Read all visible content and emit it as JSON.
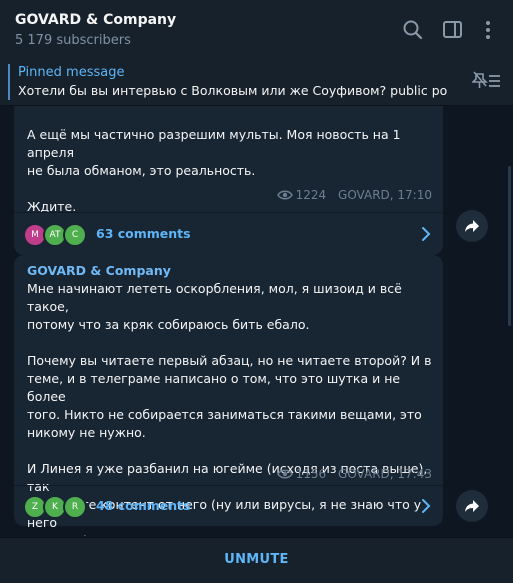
{
  "header": {
    "title": "GOVARD & Company",
    "subtitle": "5 179 subscribers",
    "icons": [
      "search-icon",
      "sidebar-toggle-icon",
      "more-vertical-icon"
    ]
  },
  "pinned": {
    "title": "Pinned message",
    "text": "Хотели бы вы интервью с Волковым или же Соуфивом? public poll ..."
  },
  "messages": [
    {
      "text": "А ещё мы частично разрешим мульты. Моя новость на 1 апреля\nне была обманом, это реальность.\n\nЖдите.",
      "views": "1224",
      "author_time": "GOVARD, 17:10",
      "comments": {
        "label": "63 comments",
        "avatars": [
          {
            "initials": "M",
            "color": "#c03d8a"
          },
          {
            "initials": "AT",
            "color": "#4fae4e"
          },
          {
            "initials": "C",
            "color": "#4fae4e"
          }
        ]
      }
    },
    {
      "author": "GOVARD & Company",
      "text": "Мне начинают лететь оскорбления, мол, я шизоид и всё такое,\nпотому что за кряк собираюсь бить ебало.\n\nПочему вы читаете первый абзац, но не читаете второй? И в\nтеме, и в телеграме написано о том, что это шутка и не более\nтого. Никто не собирается заниматься такими вещами, это\nникому не нужно.\n\nИ Линея я уже разбанил на югейме (исходя из поста выше), так\nчто ждите контент от него (ну или вирусы, я не знаю что у него\nв голове).",
      "views": "1156",
      "author_time": "GOVARD, 17:43",
      "comments": {
        "label": "48 comments",
        "avatars": [
          {
            "initials": "Z",
            "color": "#4fae4e"
          },
          {
            "initials": "K",
            "color": "#4fae4e"
          },
          {
            "initials": "R",
            "color": "#4fae4e"
          }
        ]
      }
    }
  ],
  "footer": {
    "unmute_label": "UNMUTE"
  },
  "colors": {
    "background": "#0e1621",
    "panel": "#17212b",
    "bubble": "#182533",
    "accent": "#5eb5f7"
  }
}
